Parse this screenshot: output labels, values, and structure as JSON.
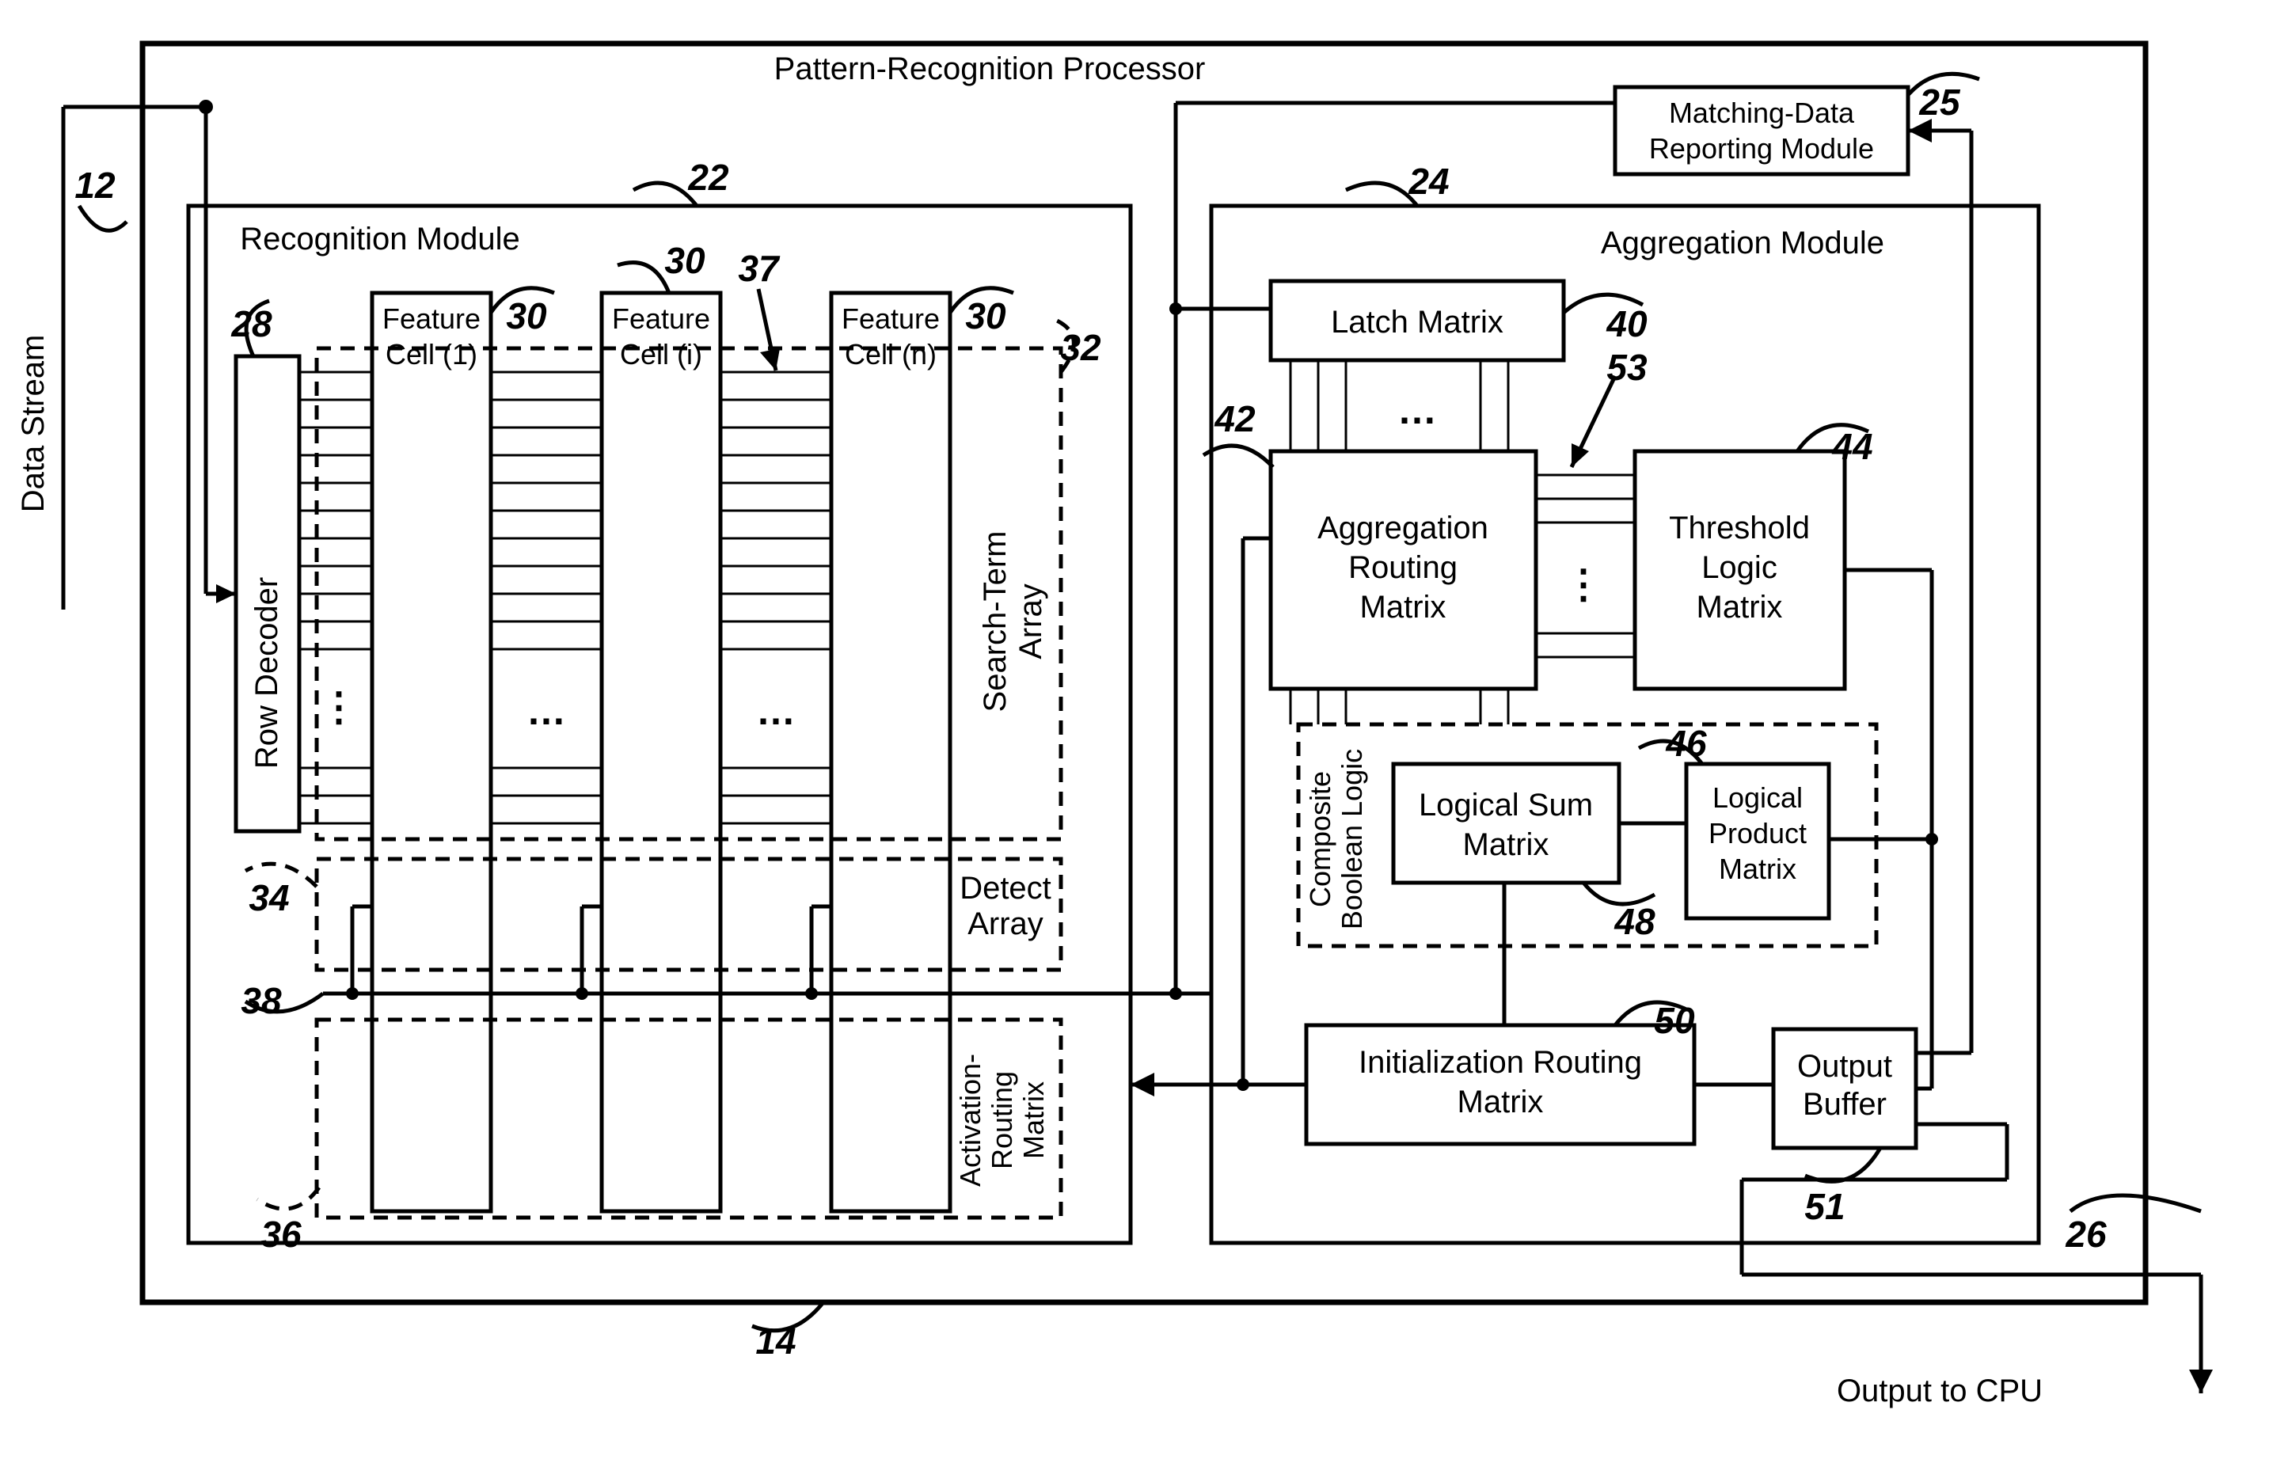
{
  "title": "Pattern-Recognition Processor",
  "input_label": "Data Stream",
  "output_label": "Output to CPU",
  "refs": {
    "data_stream_lead": "12",
    "processor": "14",
    "recognition_module": "22",
    "aggregation_module": "24",
    "matching_module": "25",
    "output_lead": "26",
    "row_decoder": "28",
    "feature_cell": "30",
    "search_term_array": "32",
    "detect_array": "34",
    "activation_routing_matrix": "36",
    "search_term_bus": "37",
    "detect_bus": "38",
    "latch_matrix": "40",
    "aggregation_routing_matrix": "42",
    "threshold_logic_matrix": "44",
    "logical_product_matrix": "46",
    "logical_sum_matrix": "48",
    "initialization_routing_matrix": "50",
    "output_buffer": "51",
    "threshold_bus": "53"
  },
  "blocks": {
    "recognition_module": "Recognition Module",
    "aggregation_module": "Aggregation Module",
    "matching_module_l1": "Matching-Data",
    "matching_module_l2": "Reporting Module",
    "row_decoder": "Row Decoder",
    "feature_cell_1_l1": "Feature",
    "feature_cell_1_l2": "Cell (1)",
    "feature_cell_i_l1": "Feature",
    "feature_cell_i_l2": "Cell (i)",
    "feature_cell_n_l1": "Feature",
    "feature_cell_n_l2": "Cell (n)",
    "search_term_array_l1": "Search-Term",
    "search_term_array_l2": "Array",
    "detect_array_l1": "Detect",
    "detect_array_l2": "Array",
    "activation_routing_l1": "Activation-",
    "activation_routing_l2": "Routing",
    "activation_routing_l3": "Matrix",
    "latch_matrix": "Latch Matrix",
    "aggregation_routing_l1": "Aggregation",
    "aggregation_routing_l2": "Routing",
    "aggregation_routing_l3": "Matrix",
    "threshold_logic_l1": "Threshold",
    "threshold_logic_l2": "Logic",
    "threshold_logic_l3": "Matrix",
    "composite_boolean_l1": "Composite",
    "composite_boolean_l2": "Boolean Logic",
    "logical_sum_l1": "Logical Sum",
    "logical_sum_l2": "Matrix",
    "logical_product_l1": "Logical",
    "logical_product_l2": "Product",
    "logical_product_l3": "Matrix",
    "initialization_routing_l1": "Initialization Routing",
    "initialization_routing_l2": "Matrix",
    "output_buffer_l1": "Output",
    "output_buffer_l2": "Buffer"
  }
}
